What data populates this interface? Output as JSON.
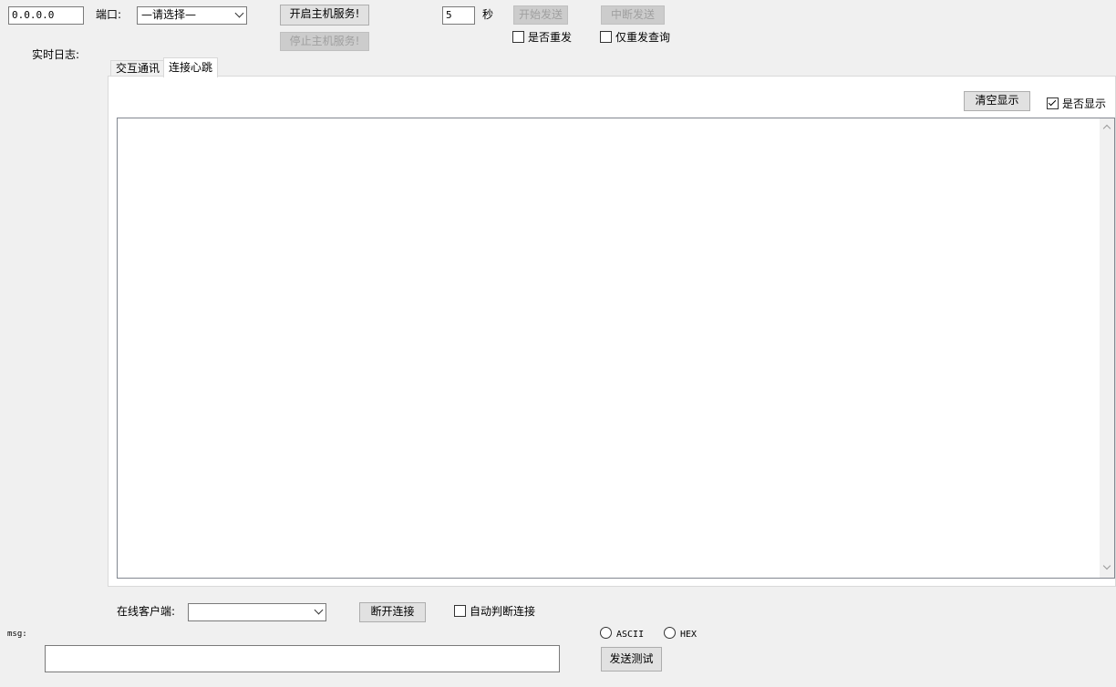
{
  "top": {
    "ip_value": "0.0.0.0",
    "port_label": "端口:",
    "port_selected": "—请选择—",
    "start_service": "开启主机服务!",
    "stop_service": "停止主机服务!",
    "interval_value": "5",
    "interval_unit": "秒",
    "start_send": "开始发送",
    "stop_send": "中断发送",
    "resend_label": "是否重发",
    "resend_query_label": "仅重发查询"
  },
  "log": {
    "label": "实时日志:",
    "tabs": [
      {
        "label": "交互通讯",
        "active": false
      },
      {
        "label": "连接心跳",
        "active": true
      }
    ],
    "clear_button": "清空显示",
    "show_label": "是否显示",
    "show_checked": true
  },
  "bottom": {
    "clients_label": "在线客户端:",
    "clients_selected": "",
    "disconnect_button": "断开连接",
    "auto_disconnect_label": "自动判断连接",
    "msg_label": "msg:",
    "msg_value": "",
    "ascii_label": "ASCII",
    "hex_label": "HEX",
    "send_test_button": "发送测试"
  }
}
